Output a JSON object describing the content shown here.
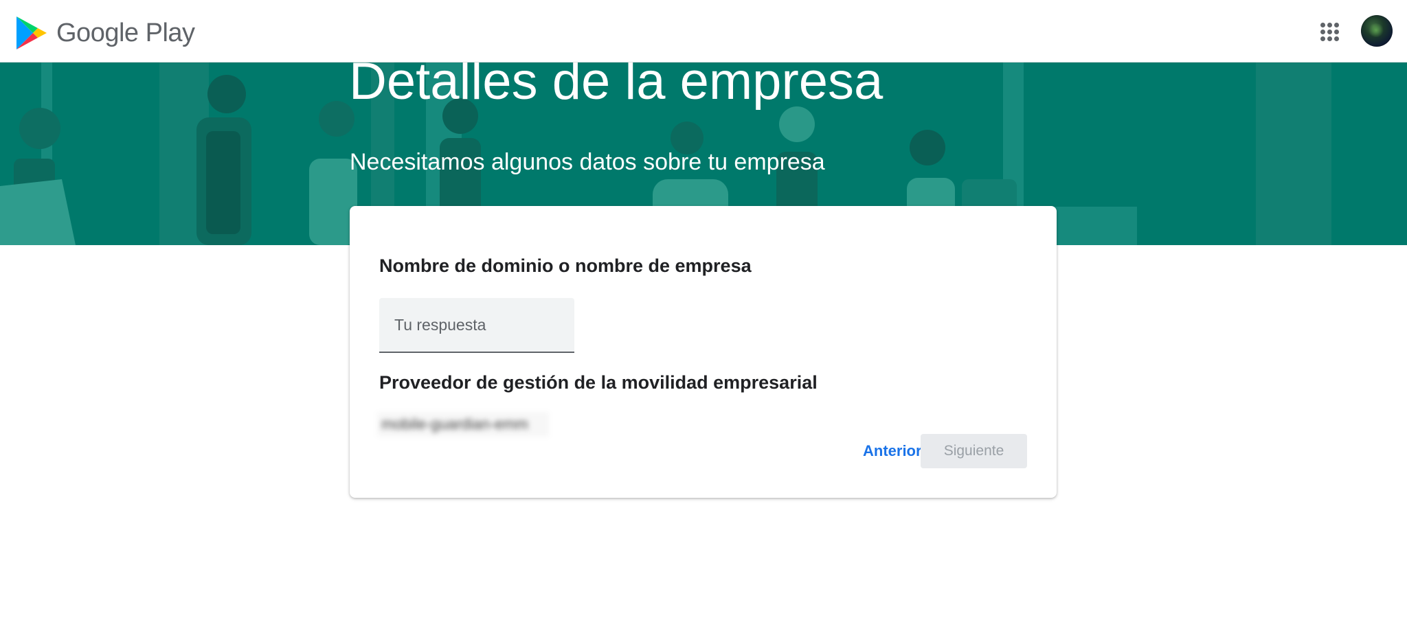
{
  "header": {
    "brand_name": "Google Play",
    "logo_icon": "google-play-icon",
    "apps_icon": "apps-grid-icon",
    "avatar": "user-avatar"
  },
  "hero": {
    "title": "Detalles de la empresa",
    "subtitle": "Necesitamos algunos datos sobre tu empresa",
    "background_color": "#00796b"
  },
  "form": {
    "question_1": {
      "label": "Nombre de dominio o nombre de empresa",
      "placeholder": "Tu respuesta",
      "value": ""
    },
    "question_2": {
      "label": "Proveedor de gestión de la movilidad empresarial",
      "value": "mobile-guardian-emm"
    },
    "buttons": {
      "previous": "Anterior",
      "next": "Siguiente"
    }
  },
  "colors": {
    "accent": "#1a73e8",
    "hero": "#00796b",
    "disabled_button_bg": "#e8eaed",
    "disabled_button_text": "#9aa0a6"
  }
}
